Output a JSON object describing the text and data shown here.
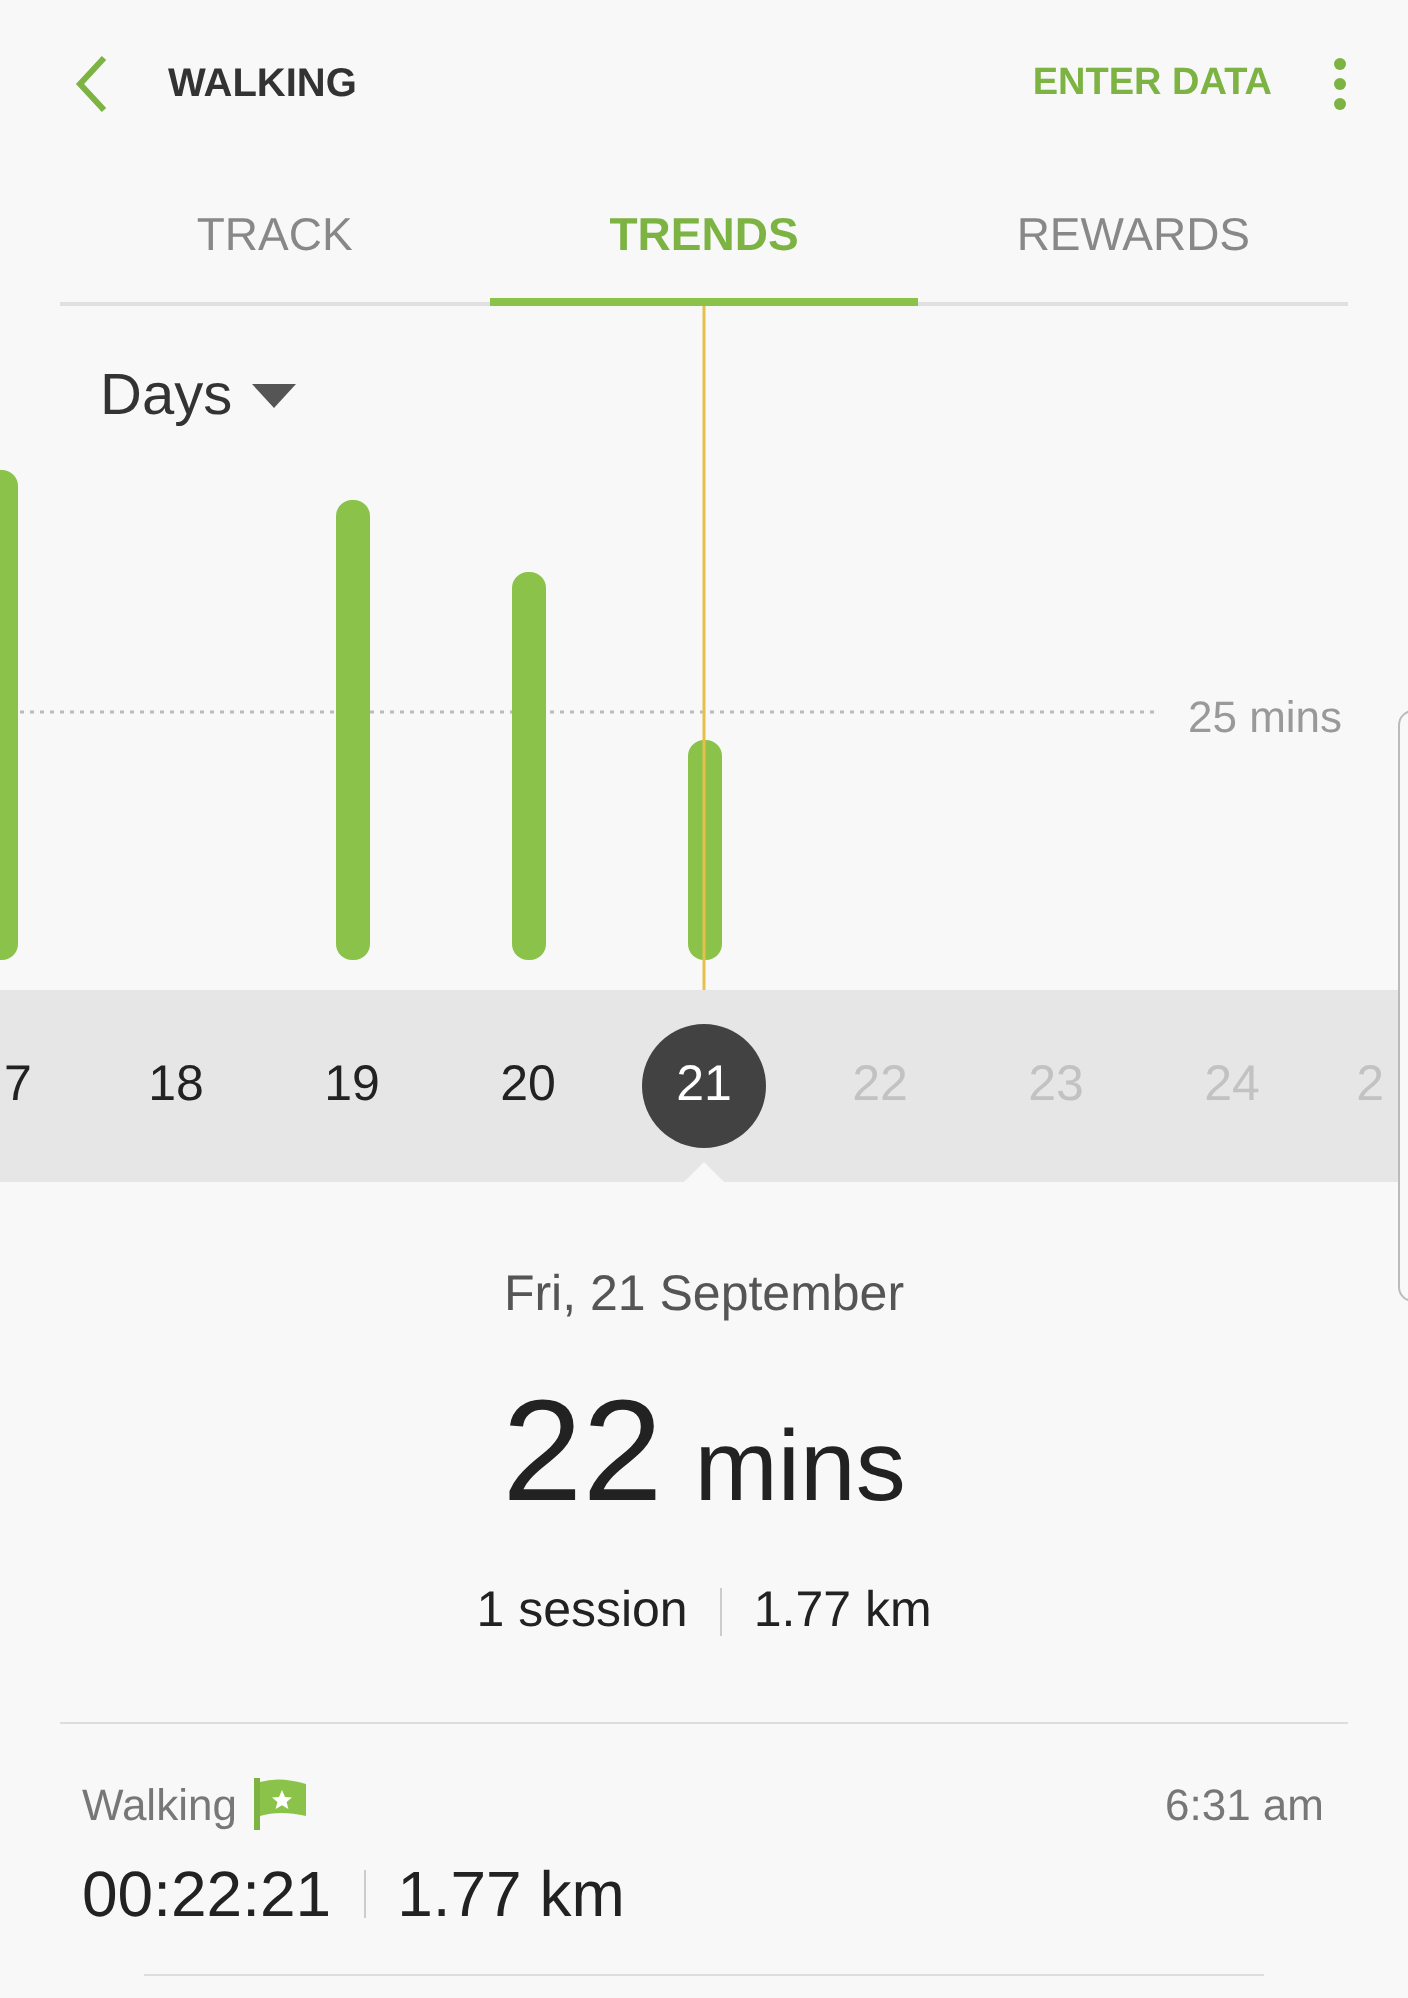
{
  "header": {
    "title": "WALKING",
    "action": "ENTER DATA"
  },
  "tabs": [
    {
      "label": "TRACK",
      "selected": false
    },
    {
      "label": "TRENDS",
      "selected": true
    },
    {
      "label": "REWARDS",
      "selected": false
    }
  ],
  "chart": {
    "period": "Days",
    "reference_label": "25 mins"
  },
  "days": [
    {
      "label": "7",
      "selected": false,
      "dimmed": false
    },
    {
      "label": "18",
      "selected": false,
      "dimmed": false
    },
    {
      "label": "19",
      "selected": false,
      "dimmed": false
    },
    {
      "label": "20",
      "selected": false,
      "dimmed": false
    },
    {
      "label": "21",
      "selected": true,
      "dimmed": false
    },
    {
      "label": "22",
      "selected": false,
      "dimmed": true
    },
    {
      "label": "23",
      "selected": false,
      "dimmed": true
    },
    {
      "label": "24",
      "selected": false,
      "dimmed": true
    },
    {
      "label": "2",
      "selected": false,
      "dimmed": true
    }
  ],
  "summary": {
    "date": "Fri, 21 September",
    "duration_value": "22",
    "duration_unit": "mins",
    "sessions": "1 session",
    "distance": "1.77 km"
  },
  "sessions": [
    {
      "name": "Walking",
      "time": "6:31 am",
      "duration": "00:22:21",
      "distance": "1.77 km"
    }
  ]
}
